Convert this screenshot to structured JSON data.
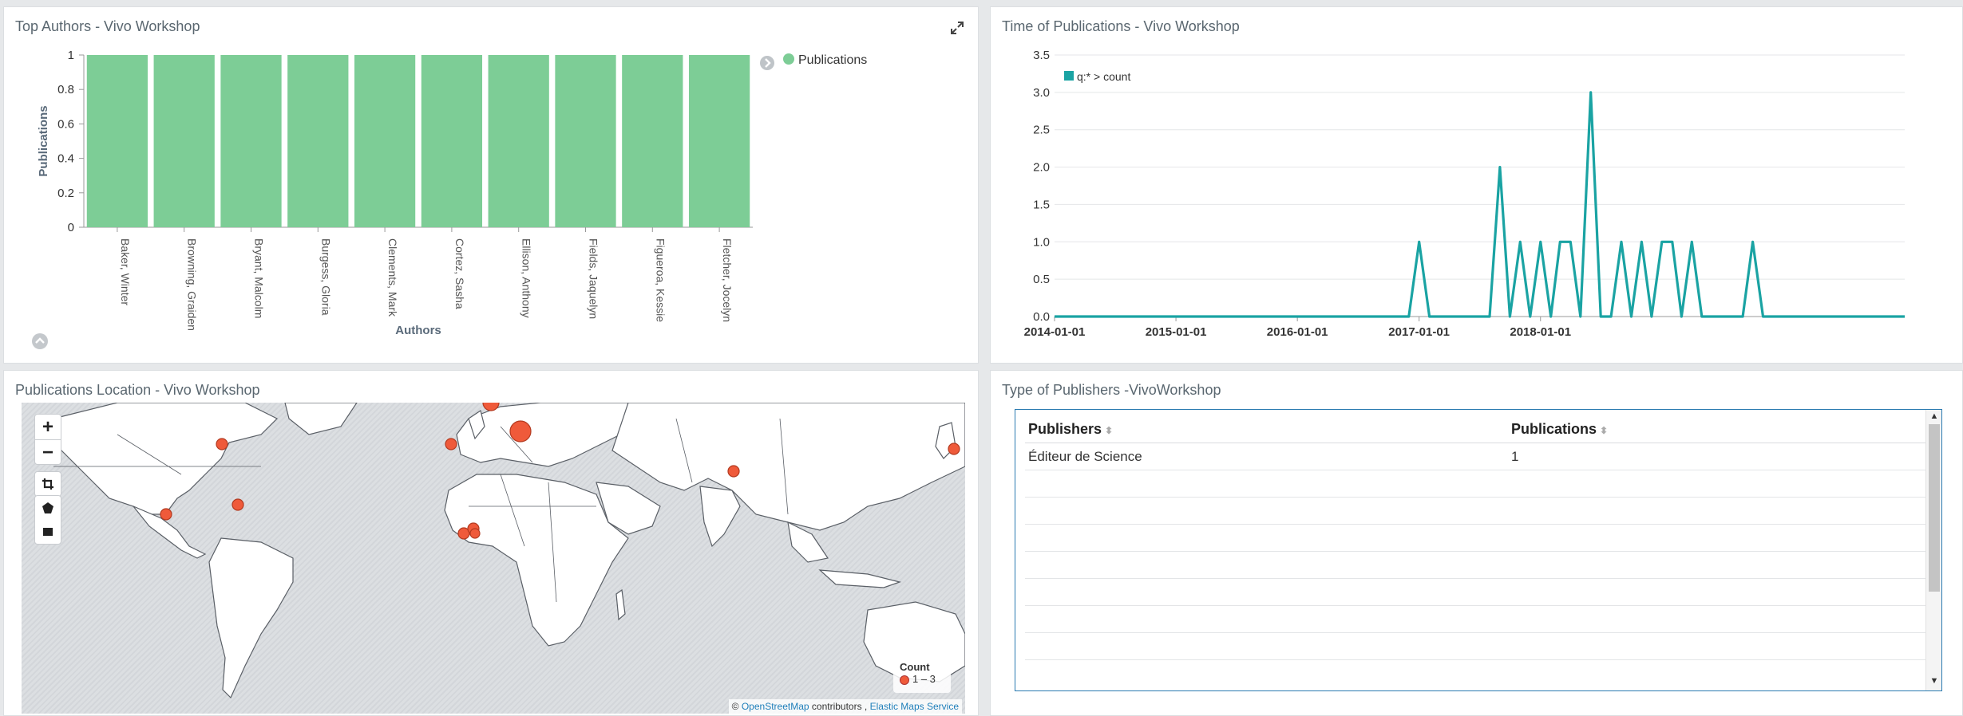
{
  "panels": {
    "top_authors": {
      "title": "Top Authors - Vivo Workshop"
    },
    "time_pubs": {
      "title": "Time of Publications - Vivo Workshop"
    },
    "location": {
      "title": "Publications Location - Vivo Workshop"
    },
    "publishers": {
      "title": "Type of Publishers -VivoWorkshop"
    }
  },
  "chart_data": [
    {
      "type": "bar",
      "title": "Top Authors - Vivo Workshop",
      "xlabel": "Authors",
      "ylabel": "Publications",
      "categories": [
        "Baker, Winter",
        "Browning, Graiden",
        "Bryant, Malcolm",
        "Burgess, Gloria",
        "Clements, Mark",
        "Cortez, Sasha",
        "Ellison, Anthony",
        "Fields, Jaquelyn",
        "Figueroa, Kessie",
        "Fletcher, Jocelyn"
      ],
      "series": [
        {
          "name": "Publications",
          "values": [
            1,
            1,
            1,
            1,
            1,
            1,
            1,
            1,
            1,
            1
          ]
        }
      ],
      "ylim": [
        0,
        1
      ],
      "yticks": [
        "0",
        "0.2",
        "0.4",
        "0.6",
        "0.8",
        "1"
      ],
      "color": "#7dcd96",
      "legend": "top-right"
    },
    {
      "type": "line",
      "title": "Time of Publications - Vivo Workshop",
      "xlabel": "",
      "ylabel": "",
      "series": [
        {
          "name": "q:* > count",
          "points": [
            [
              "2014-01-01",
              0
            ],
            [
              "2016-12-01",
              0
            ],
            [
              "2017-01-01",
              1
            ],
            [
              "2017-02-01",
              0
            ],
            [
              "2017-08-01",
              0
            ],
            [
              "2017-09-01",
              2
            ],
            [
              "2017-10-01",
              0
            ],
            [
              "2017-11-01",
              1
            ],
            [
              "2017-12-01",
              0
            ],
            [
              "2018-01-01",
              1
            ],
            [
              "2018-02-01",
              0
            ],
            [
              "2018-03-01",
              1
            ],
            [
              "2018-04-01",
              1
            ],
            [
              "2018-05-01",
              0
            ],
            [
              "2018-06-01",
              3
            ],
            [
              "2018-07-01",
              0
            ],
            [
              "2018-08-01",
              0
            ],
            [
              "2018-09-01",
              1
            ],
            [
              "2018-10-01",
              0
            ],
            [
              "2018-11-01",
              1
            ],
            [
              "2018-12-01",
              0
            ],
            [
              "2019-01-01",
              1
            ],
            [
              "2019-02-01",
              1
            ],
            [
              "2019-03-01",
              0
            ],
            [
              "2019-04-01",
              1
            ],
            [
              "2019-05-01",
              0
            ],
            [
              "2019-09-01",
              0
            ],
            [
              "2019-10-01",
              1
            ],
            [
              "2019-11-01",
              0
            ],
            [
              "2020-12-31",
              0
            ]
          ]
        }
      ],
      "xticks": [
        "2014-01-01",
        "2015-01-01",
        "2016-01-01",
        "2017-01-01",
        "2018-01-01"
      ],
      "yticks": [
        "0.0",
        "0.5",
        "1.0",
        "1.5",
        "2.0",
        "2.5",
        "3.0",
        "3.5"
      ],
      "ylim": [
        0,
        3.5
      ],
      "color": "#1aa3a3",
      "legend": "top-left"
    }
  ],
  "map": {
    "zoom_in": "+",
    "zoom_out": "−",
    "legend_title": "Count",
    "legend_range": "1 – 3",
    "attribution_prefix": "©",
    "attribution_osm": "OpenStreetMap",
    "attribution_mid": "contributors ,",
    "attribution_ems": "Elastic Maps Service",
    "marker_color": "#ef5a3a"
  },
  "publishers_table": {
    "columns": [
      "Publishers",
      "Publications"
    ],
    "rows": [
      [
        "Éditeur de Science",
        "1"
      ]
    ]
  }
}
